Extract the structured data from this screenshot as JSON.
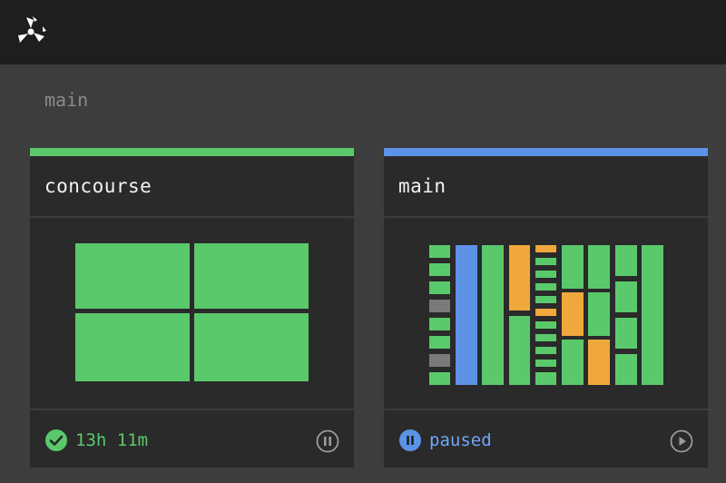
{
  "team": {
    "name": "main"
  },
  "colors": {
    "succeeded": "#5ac96b",
    "paused": "#5c93e6",
    "pending": "#f0a83c",
    "aborted": "#7a7a7a"
  },
  "pipelines": [
    {
      "name": "concourse",
      "status_color": "#5ac96b",
      "status_text": "13h 11m",
      "status_icon": "check-circle-icon",
      "action_icon": "pause-icon"
    },
    {
      "name": "main",
      "status_color": "#5c93e6",
      "status_text": "paused",
      "status_icon": "pause-circle-icon",
      "action_icon": "play-icon"
    }
  ]
}
